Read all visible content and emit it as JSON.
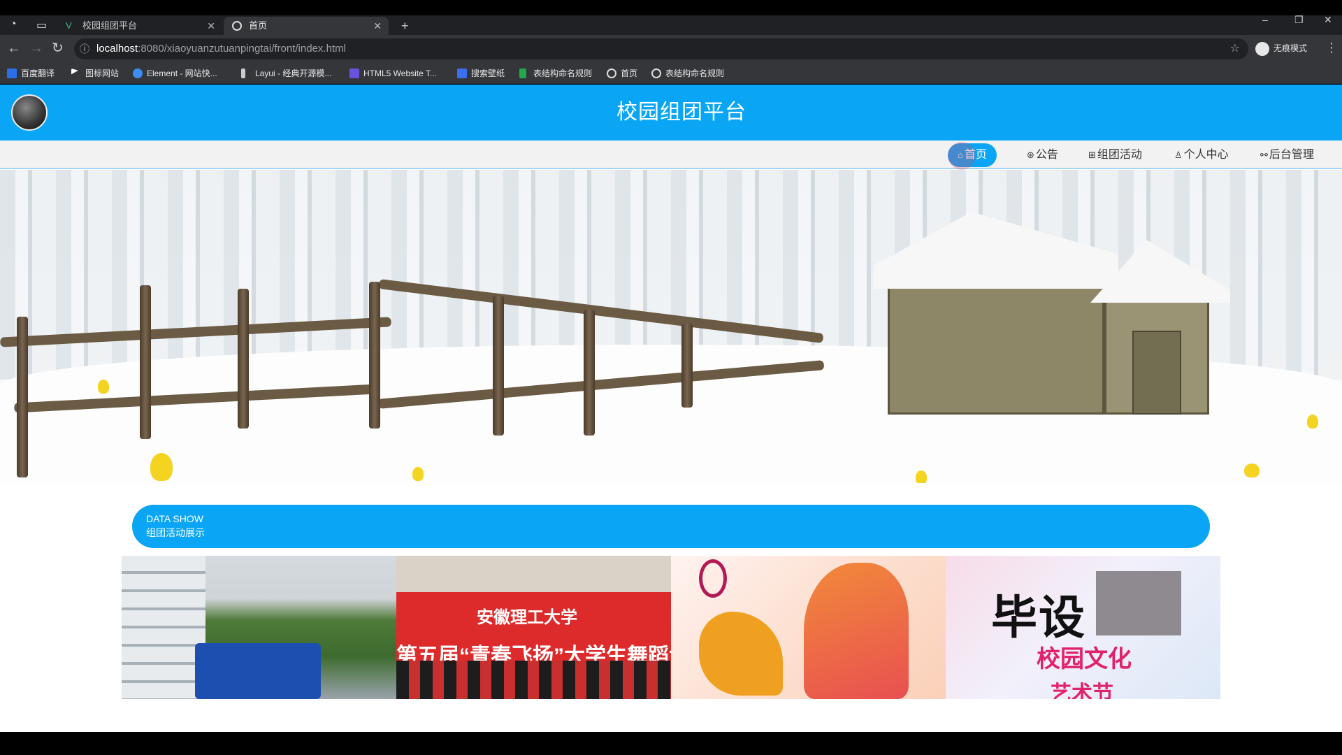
{
  "browser": {
    "tabs": [
      {
        "title": "校园组团平台",
        "active": false
      },
      {
        "title": "首页",
        "active": true
      }
    ],
    "url_host": "localhost",
    "url_path": ":8080/xiaoyuanzutuanpingtai/front/index.html",
    "profile_label": "无痕模式",
    "bookmarks": [
      {
        "label": "百度翻译",
        "icon": "translate-icon",
        "color": "#2a6ee8"
      },
      {
        "label": "图标网站",
        "icon": "flag-icon",
        "color": "#ffffff"
      },
      {
        "label": "Element - 网站快...",
        "icon": "element-icon",
        "color": "#3d8ef0"
      },
      {
        "label": "Layui - 经典开源模...",
        "icon": "layui-icon",
        "color": "#cccccc"
      },
      {
        "label": "HTML5 Website T...",
        "icon": "html5-icon",
        "color": "#6a52e0"
      },
      {
        "label": "搜索壁纸",
        "icon": "wallpaper-icon",
        "color": "#3b6ef0"
      },
      {
        "label": "表结构命名规则",
        "icon": "sheet-icon",
        "color": "#22a84f"
      },
      {
        "label": "首页",
        "icon": "globe-icon",
        "color": "#dddddd"
      },
      {
        "label": "表结构命名规则",
        "icon": "globe-icon",
        "color": "#dddddd"
      }
    ]
  },
  "site": {
    "title": "校园组团平台",
    "accent": "#0aa6f5",
    "nav": [
      {
        "label": "首页",
        "icon": "home-icon",
        "active": true
      },
      {
        "label": "公告",
        "icon": "bell-icon",
        "active": false
      },
      {
        "label": "组团活动",
        "icon": "grid-icon",
        "active": false
      },
      {
        "label": "个人中心",
        "icon": "user-icon",
        "active": false
      },
      {
        "label": "后台管理",
        "icon": "link-icon",
        "active": false
      }
    ],
    "carousel": {
      "slides": 3,
      "current": 1
    },
    "section": {
      "en": "DATA SHOW",
      "zh": "组团活动展示"
    },
    "gallery": {
      "g2_line1": "安徽理工大学",
      "g2_line2": "第五届“青春飞扬”大学生舞蹈大",
      "g4_big": "毕设",
      "g4_sub": "校园文化",
      "g4_sub2": "艺术节"
    }
  }
}
